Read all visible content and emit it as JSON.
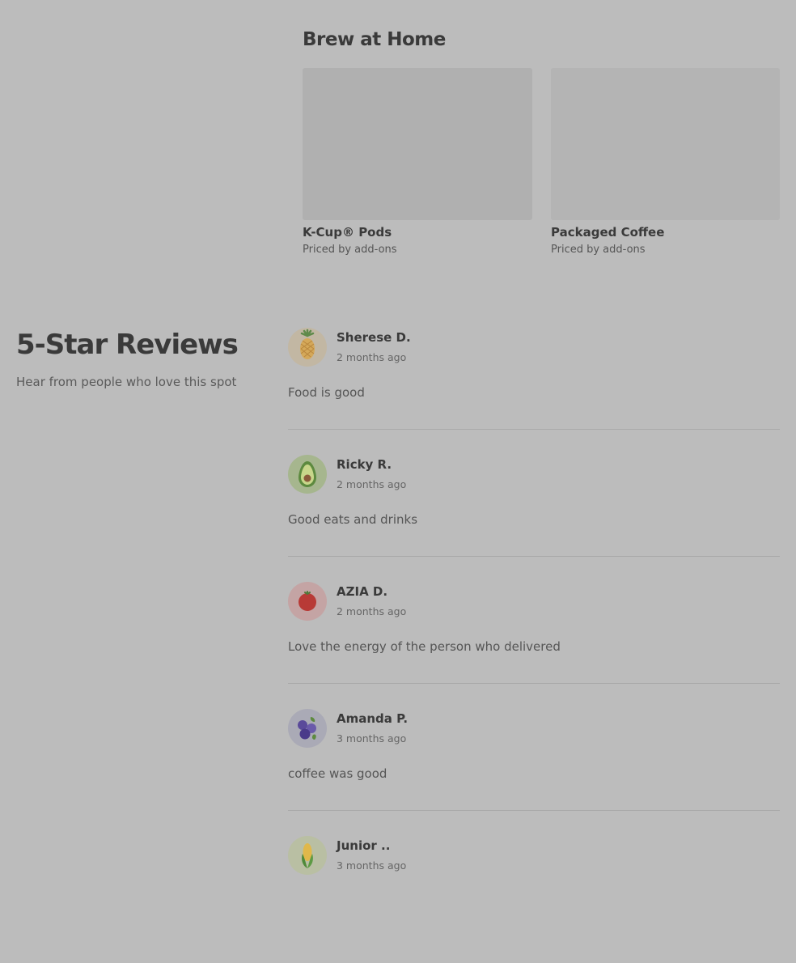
{
  "brew": {
    "title": "Brew at Home",
    "products": [
      {
        "name": "K-Cup® Pods",
        "price": "Priced by add-ons"
      },
      {
        "name": "Packaged Coffee",
        "price": "Priced by add-ons"
      }
    ]
  },
  "reviews": {
    "title": "5-Star Reviews",
    "subtitle": "Hear from people who love this spot",
    "items": [
      {
        "name": "Sherese D.",
        "date": "2 months ago",
        "text": "Food is good",
        "avatar": "pineapple-icon"
      },
      {
        "name": "Ricky R.",
        "date": "2 months ago",
        "text": "Good eats and drinks",
        "avatar": "avocado-icon"
      },
      {
        "name": "AZIA D.",
        "date": "2 months ago",
        "text": "Love the energy of the person who delivered",
        "avatar": "tomato-icon"
      },
      {
        "name": "Amanda P.",
        "date": "3 months ago",
        "text": "coffee was good",
        "avatar": "blueberry-icon"
      },
      {
        "name": "Junior ..",
        "date": "3 months ago",
        "text": "",
        "avatar": "corn-icon"
      }
    ]
  },
  "colors": {
    "background": "#bcbcbc",
    "text_primary": "#3a3a3a",
    "divider": "#a9a9a9"
  }
}
